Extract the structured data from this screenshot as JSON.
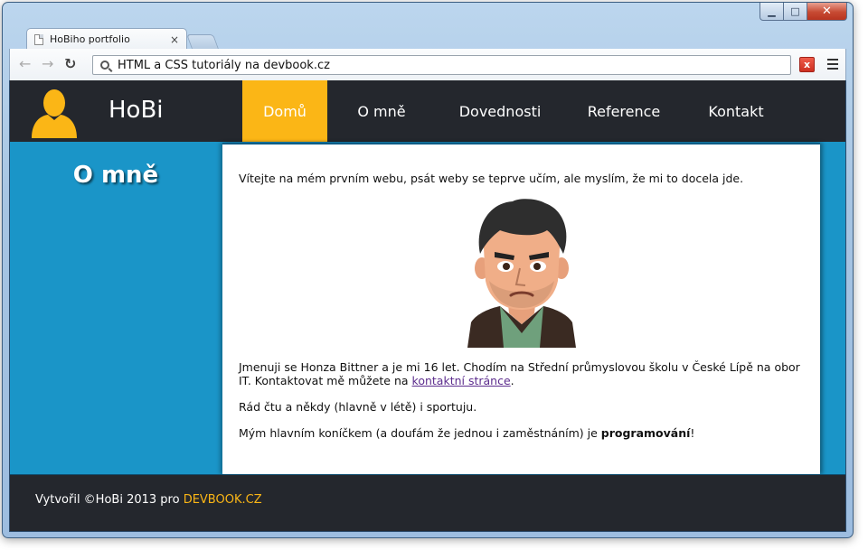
{
  "browser": {
    "tab_title": "HoBiho portfolio",
    "tab_close": "×",
    "url": "HTML a CSS tutoriály na devbook.cz",
    "window_controls": {
      "minimize": "▁",
      "maximize": "□",
      "close": "✕"
    },
    "nav": {
      "back": "←",
      "forward": "→",
      "reload": "↻"
    },
    "extension_label": "x"
  },
  "site": {
    "name": "HoBi",
    "nav": [
      {
        "label": "Domů",
        "active": true
      },
      {
        "label": "O mně",
        "active": false
      },
      {
        "label": "Dovednosti",
        "active": false
      },
      {
        "label": "Reference",
        "active": false
      },
      {
        "label": "Kontakt",
        "active": false
      }
    ]
  },
  "sidebar": {
    "title": "O mně"
  },
  "content": {
    "intro": "Vítejte na mém prvním webu, psát weby se teprve učím, ale myslím, že mi to docela jde.",
    "about_start": "Jmenuji se Honza Bittner a je mi 16 let. Chodím na Střední průmyslovou školu v České Lípě na obor IT. Kontaktovat mě můžete na ",
    "contact_link": "kontaktní stránce",
    "about_end": ".",
    "hobbies": "Rád čtu a někdy (hlavně v létě) i sportuju.",
    "main_hobby_start": "Mým hlavním koníčkem (a doufám že jednou i zaměstnáním) je ",
    "main_hobby_bold": "programování",
    "main_hobby_end": "!"
  },
  "footer": {
    "text": "Vytvořil ©HoBi 2013 pro ",
    "link": "DEVBOOK.CZ"
  },
  "colors": {
    "accent": "#fbb616",
    "header_bg": "#24272d",
    "page_bg": "#1a95c8",
    "link": "#5d2d8e"
  }
}
